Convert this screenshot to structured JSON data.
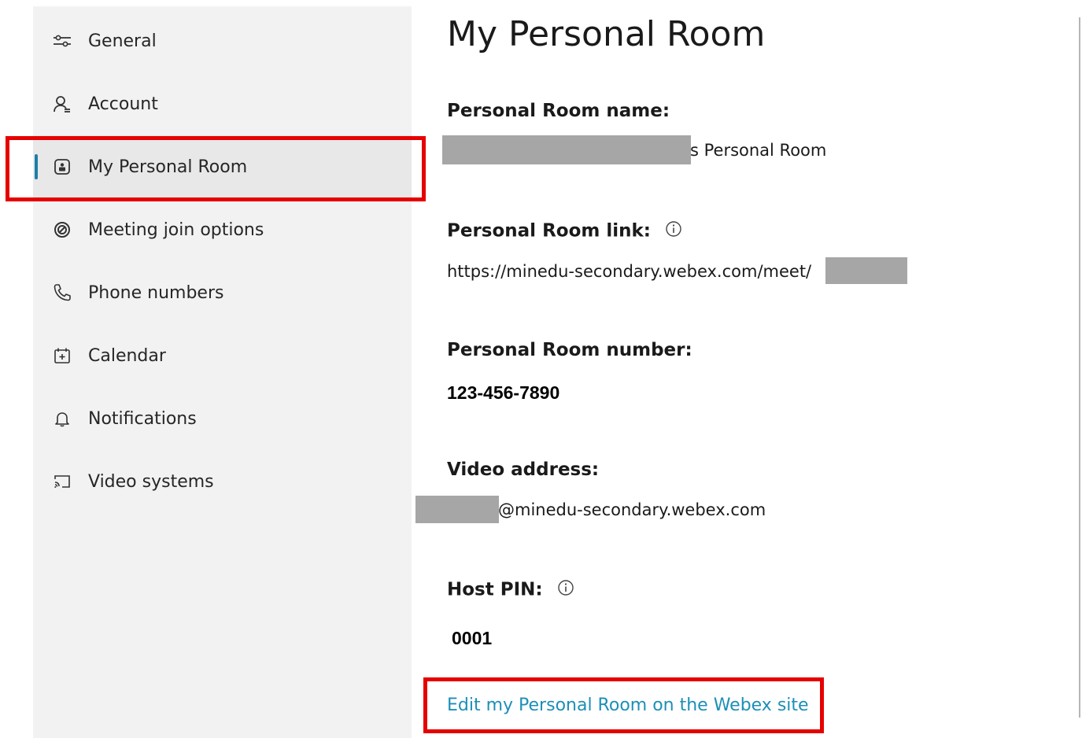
{
  "sidebar": {
    "items": [
      {
        "label": "General",
        "icon": "sliders-icon"
      },
      {
        "label": "Account",
        "icon": "person-icon"
      },
      {
        "label": "My Personal Room",
        "icon": "personal-room-icon",
        "active": true
      },
      {
        "label": "Meeting join options",
        "icon": "join-options-icon"
      },
      {
        "label": "Phone numbers",
        "icon": "phone-icon"
      },
      {
        "label": "Calendar",
        "icon": "calendar-icon"
      },
      {
        "label": "Notifications",
        "icon": "bell-icon"
      },
      {
        "label": "Video systems",
        "icon": "cast-icon"
      }
    ]
  },
  "main": {
    "title": "My Personal Room",
    "room_name_label": "Personal Room name:",
    "room_name_value": "s Personal Room",
    "room_link_label": "Personal Room link:",
    "room_link_value": "https://minedu-secondary.webex.com/meet/",
    "room_number_label": "Personal Room number:",
    "room_number_value": "123-456-7890",
    "video_address_label": "Video address:",
    "video_address_value": "@minedu-secondary.webex.com",
    "host_pin_label": "Host PIN:",
    "host_pin_value": "0001",
    "edit_link": "Edit my Personal Room on the Webex site"
  },
  "colors": {
    "accent": "#1c7fa6",
    "link": "#1c8fb8",
    "highlight": "#e60000",
    "sidebar_bg": "#f2f2f2",
    "redaction": "#a6a6a6"
  }
}
